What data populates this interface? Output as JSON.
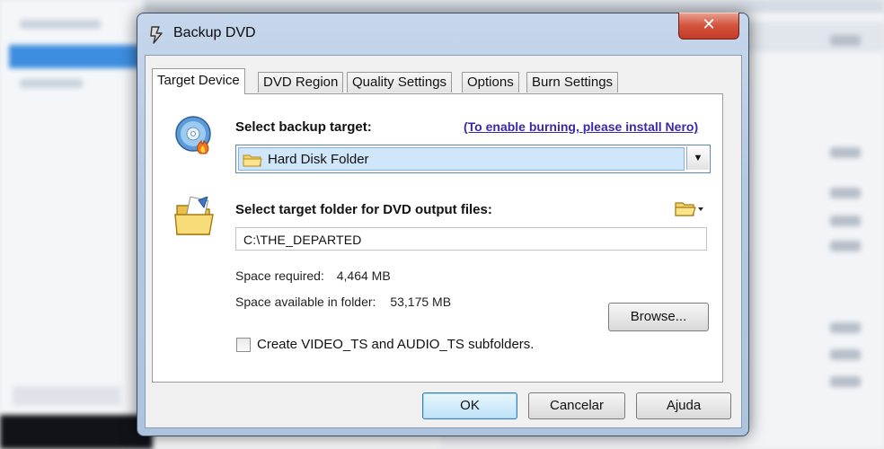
{
  "window": {
    "title": "Backup DVD",
    "close_label": "✕"
  },
  "tabs": [
    {
      "label": "Target Device",
      "active": true
    },
    {
      "label": "DVD Region",
      "active": false
    },
    {
      "label": "Quality Settings",
      "active": false
    },
    {
      "label": "Options",
      "active": false
    },
    {
      "label": "Burn Settings",
      "active": false
    }
  ],
  "target": {
    "heading": "Select backup target:",
    "nero_link": "(To enable burning, please install Nero)",
    "selected_value": "Hard Disk Folder",
    "dropdown_arrow": "▼"
  },
  "folder": {
    "heading": "Select target folder for DVD output files:",
    "path_value": "C:\\THE_DEPARTED",
    "space_required_label": "Space required:",
    "space_required_value": "4,464 MB",
    "space_available_label": "Space available in folder:",
    "space_available_value": "53,175 MB",
    "browse_label": "Browse..."
  },
  "subfolders": {
    "label": "Create VIDEO_TS and AUDIO_TS subfolders.",
    "checked": false
  },
  "footer": {
    "ok_label": "OK",
    "cancel_label": "Cancelar",
    "help_label": "Ajuda"
  },
  "icons": {
    "app": "dvd-app-icon",
    "disc": "disc-burn-icon",
    "folder": "open-folder-icon",
    "combo_folder": "folder-icon",
    "folder_menu": "folder-menu-icon"
  },
  "colors": {
    "link": "#3e28a4",
    "close_button": "#d3533e",
    "selection": "#cfe6fb",
    "default_button_border": "#3c7fb1"
  }
}
